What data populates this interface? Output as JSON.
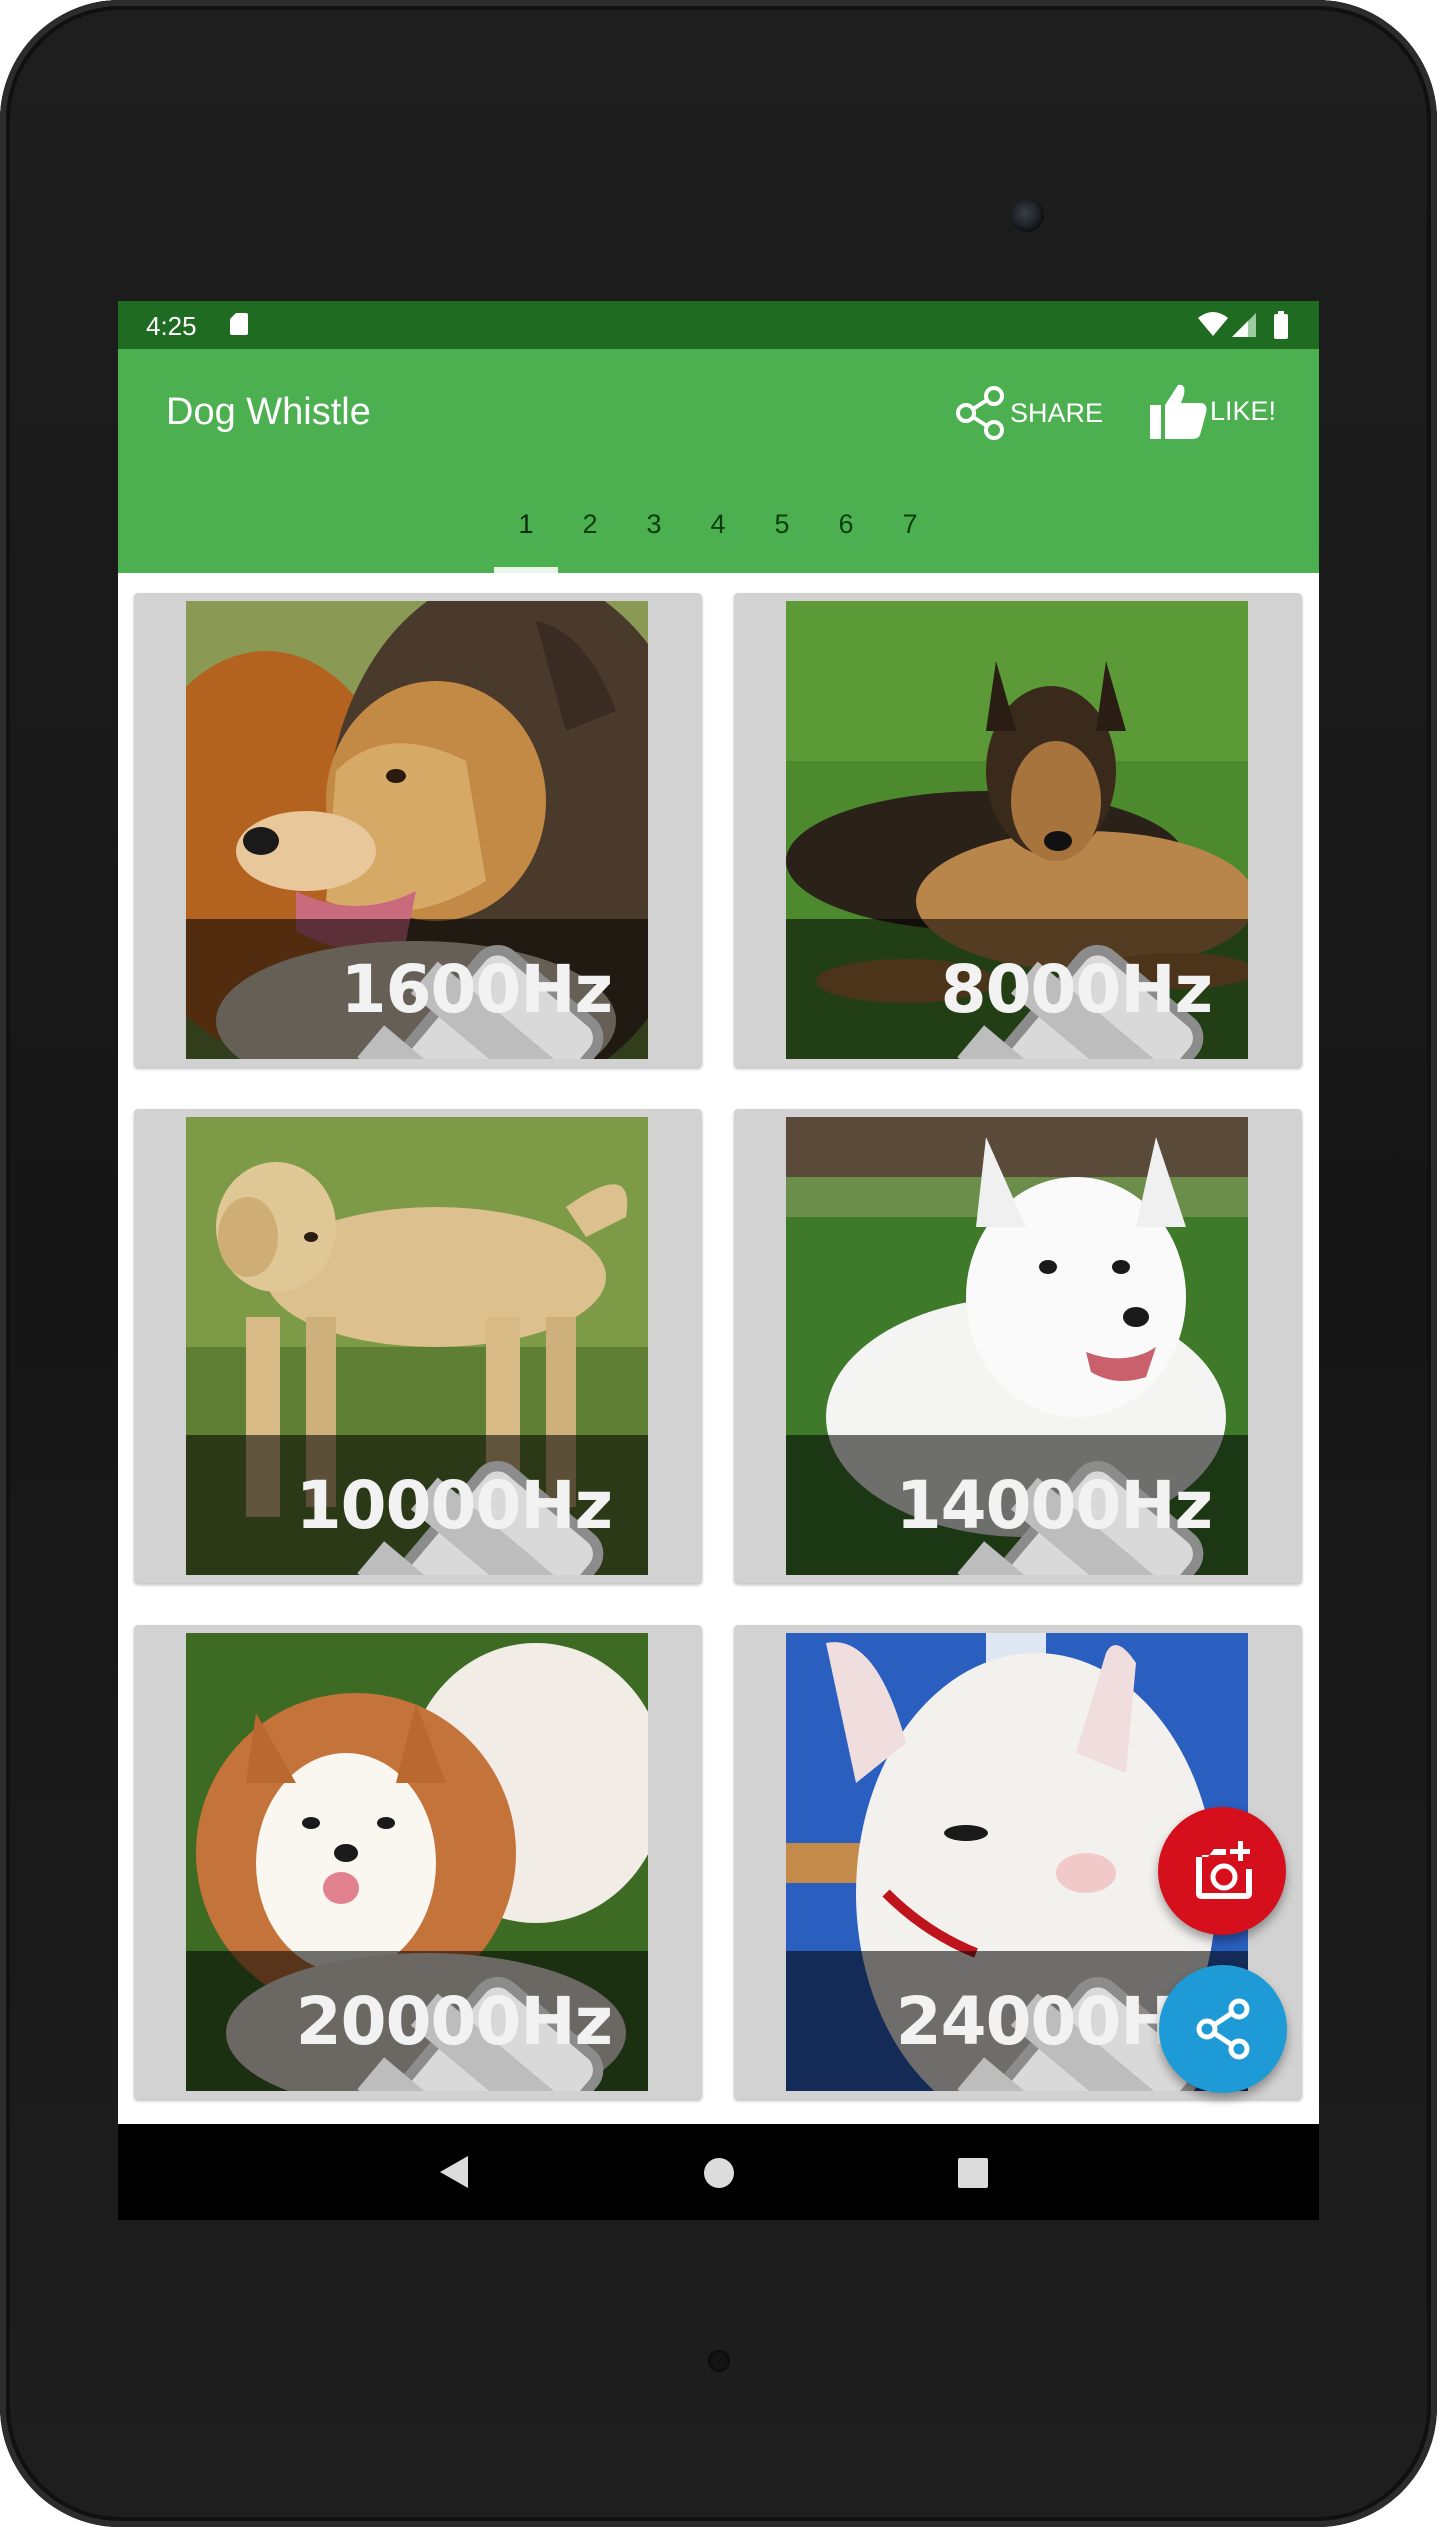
{
  "status_bar": {
    "time": "4:25"
  },
  "app_bar": {
    "title": "Dog Whistle",
    "share_label": "SHARE",
    "like_label": "LIKE!"
  },
  "tabs": [
    {
      "label": "1",
      "selected": true
    },
    {
      "label": "2"
    },
    {
      "label": "3"
    },
    {
      "label": "4"
    },
    {
      "label": "5"
    },
    {
      "label": "6"
    },
    {
      "label": "7"
    }
  ],
  "whistles": [
    {
      "frequency": "1600Hz",
      "dog": "collie"
    },
    {
      "frequency": "8000Hz",
      "dog": "german-shepherd"
    },
    {
      "frequency": "10000Hz",
      "dog": "labrador"
    },
    {
      "frequency": "14000Hz",
      "dog": "american-eskimo"
    },
    {
      "frequency": "20000Hz",
      "dog": "pomeranian"
    },
    {
      "frequency": "24000Hz",
      "dog": "bull-terrier"
    }
  ],
  "colors": {
    "status_bar": "#1f6b21",
    "app_bar": "#4caf50",
    "fab_camera": "#d50f1b",
    "fab_share": "#1e9ad6"
  },
  "icons": {
    "share": "share-icon",
    "like": "thumbs-up-icon",
    "whistle": "whistle-icon",
    "camera": "add-photo-icon"
  }
}
